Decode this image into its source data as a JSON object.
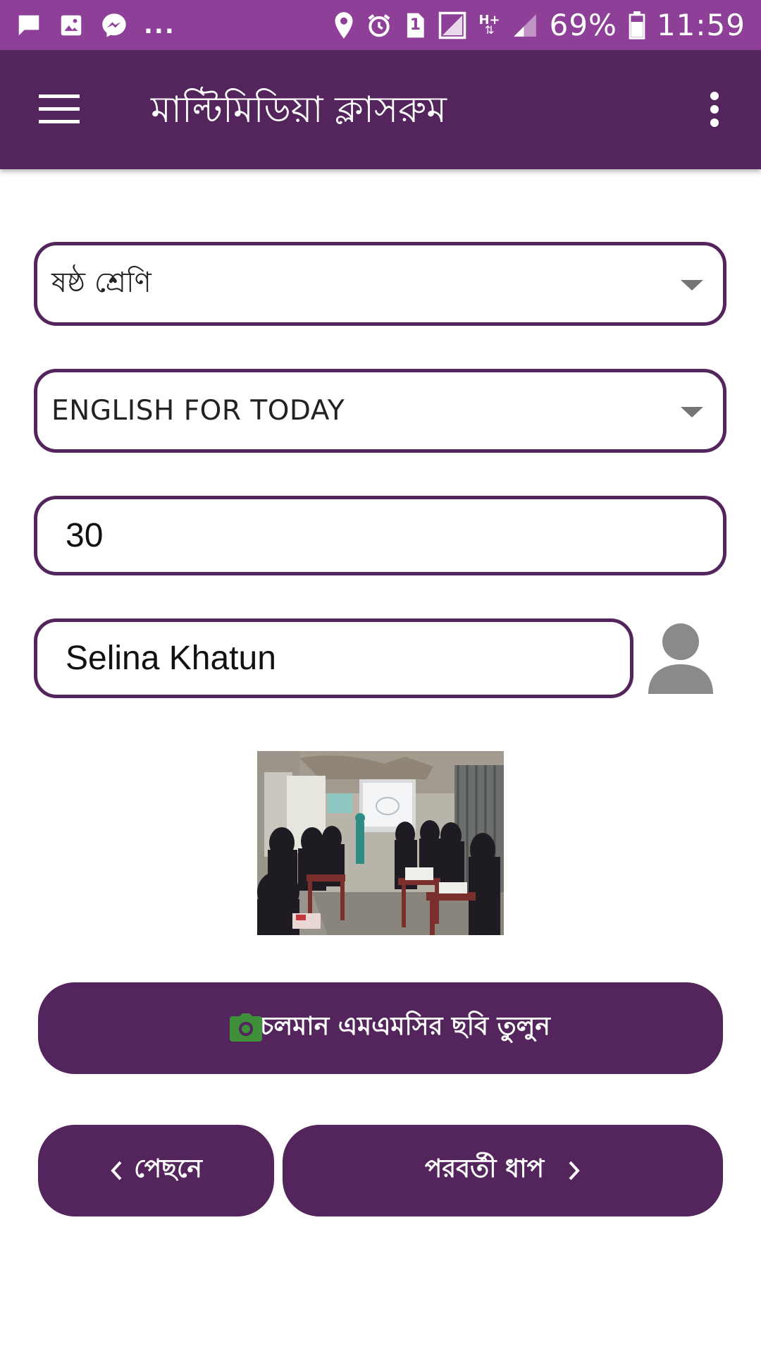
{
  "status_bar": {
    "battery_text": "69%",
    "time": "11:59",
    "network_text": "H+",
    "sim_slot": "1",
    "more_notifications": "...",
    "icons": [
      "message-icon",
      "image-icon",
      "messenger-icon",
      "location-icon",
      "alarm-icon",
      "sim-icon",
      "signal-icon",
      "battery-icon"
    ]
  },
  "app_bar": {
    "title": "মাল্টিমিডিয়া ক্লাসরুম",
    "icons": [
      "hamburger-menu-icon",
      "overflow-menu-icon"
    ]
  },
  "form": {
    "class_select": {
      "value": "ষষ্ঠ শ্রেণি"
    },
    "subject_select": {
      "value": "ENGLISH FOR TODAY"
    },
    "count_input": {
      "value": "30"
    },
    "teacher_input": {
      "value": "Selina Khatun"
    },
    "avatar_icon": "person-icon"
  },
  "buttons": {
    "camera_label": "চলমান এমএমসির ছবি তুলুন",
    "camera_icon": "camera-icon",
    "back_label": "পেছনে",
    "next_label": "পরবর্তী ধাপ"
  },
  "colors": {
    "status_bar": "#8e3f98",
    "primary": "#54245c",
    "camera_icon": "#3f8f3a",
    "avatar": "#8a8a8a",
    "caret": "#757575"
  }
}
